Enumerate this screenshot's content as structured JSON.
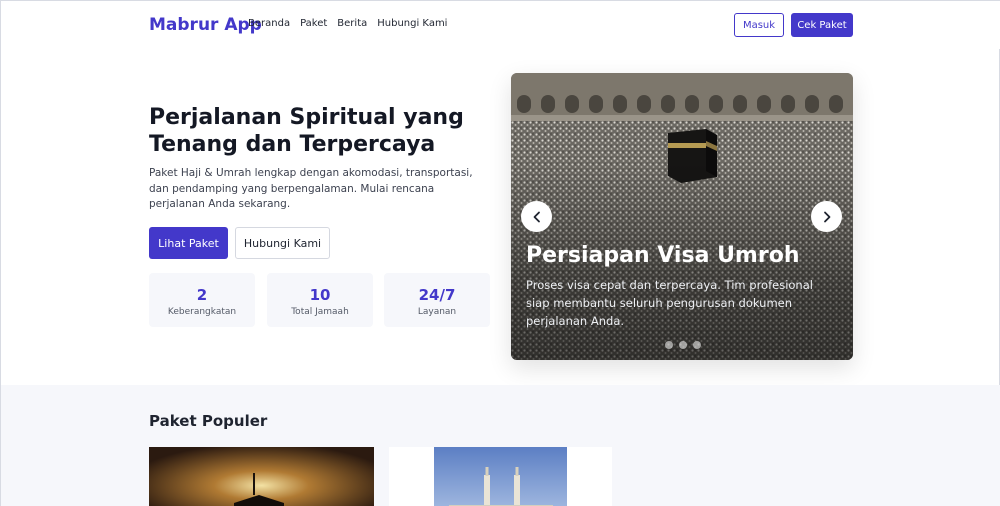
{
  "header": {
    "brand": "Mabrur App",
    "nav": [
      "Beranda",
      "Paket",
      "Berita",
      "Hubungi Kami"
    ],
    "login_label": "Masuk",
    "check_label": "Cek Paket"
  },
  "hero": {
    "title": "Perjalanan Spiritual yang Tenang dan Terpercaya",
    "description": "Paket Haji & Umrah lengkap dengan akomodasi, transportasi, dan pendamping yang berpengalaman. Mulai rencana perjalanan Anda sekarang.",
    "primary_button": "Lihat Paket",
    "secondary_button": "Hubungi Kami",
    "stats": [
      {
        "value": "2",
        "label": "Keberangkatan"
      },
      {
        "value": "10",
        "label": "Total Jamaah"
      },
      {
        "value": "24/7",
        "label": "Layanan"
      }
    ]
  },
  "carousel": {
    "title": "Persiapan Visa Umroh",
    "description": "Proses visa cepat dan terpercaya. Tim profesional siap membantu seluruh pengurusan dokumen perjalanan Anda.",
    "slide_count": 3
  },
  "popular": {
    "title": "Paket Populer"
  },
  "colors": {
    "accent": "#4338ca",
    "section_bg": "#f6f7fb"
  }
}
